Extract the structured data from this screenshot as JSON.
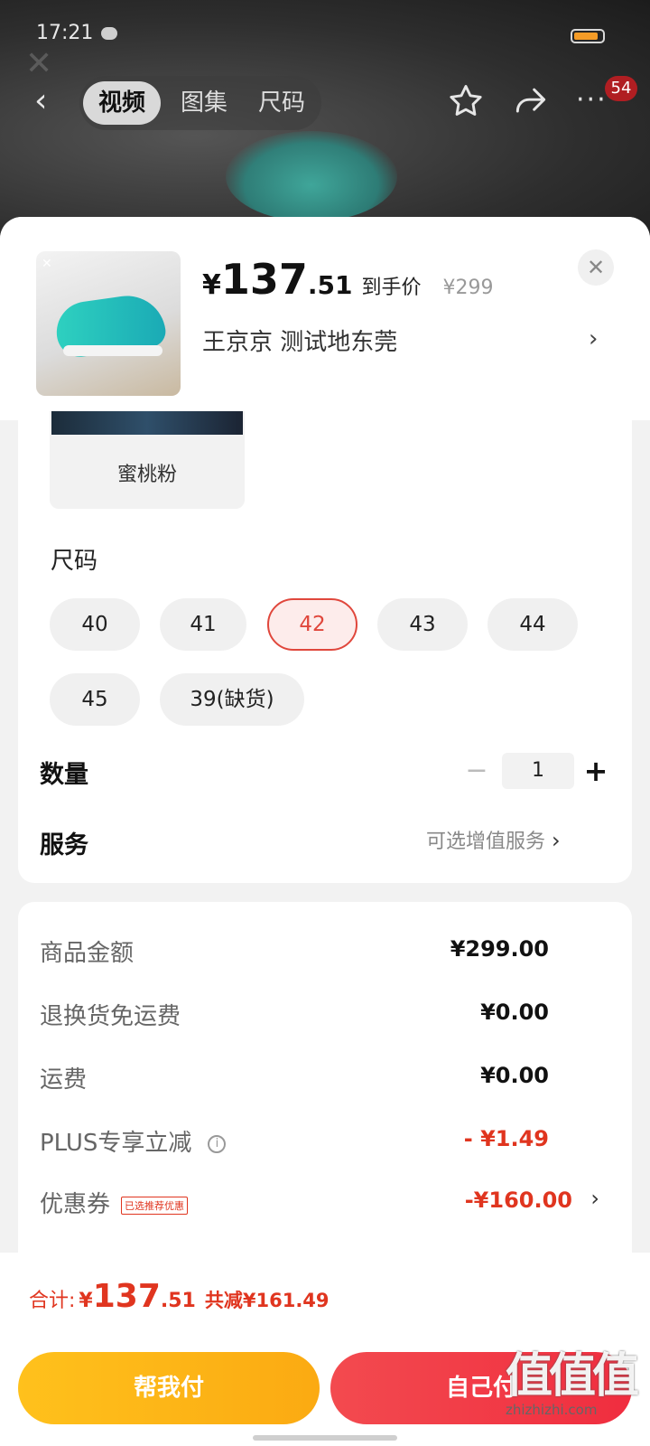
{
  "status_bar": {
    "time": "17:21"
  },
  "header": {
    "tabs": [
      {
        "label": "视频",
        "active": true
      },
      {
        "label": "图集",
        "active": false
      },
      {
        "label": "尺码",
        "active": false
      }
    ],
    "badge_count": "54",
    "icons": [
      "back-icon",
      "star-icon",
      "share-icon",
      "more-icon"
    ]
  },
  "product": {
    "price_symbol": "¥",
    "price_int": "137",
    "price_dec": ".51",
    "price_tag": "到手价",
    "original_price": "¥299",
    "address": "王京京  测试地东莞",
    "address_chevron": "›",
    "close_glyph": "✕"
  },
  "color_option": {
    "label": "蜜桃粉"
  },
  "sizes": {
    "title": "尺码",
    "options": [
      {
        "label": "40",
        "selected": false
      },
      {
        "label": "41",
        "selected": false
      },
      {
        "label": "42",
        "selected": true
      },
      {
        "label": "43",
        "selected": false
      },
      {
        "label": "44",
        "selected": false
      },
      {
        "label": "45",
        "selected": false
      },
      {
        "label": "39(缺货)",
        "selected": false
      }
    ]
  },
  "quantity": {
    "label": "数量",
    "value": "1",
    "minus": "−",
    "plus": "+"
  },
  "service": {
    "label": "服务",
    "hint": "可选增值服务",
    "chevron": "›"
  },
  "price_breakdown": [
    {
      "label": "商品金额",
      "value": "¥299.00",
      "red": false
    },
    {
      "label": "退换货免运费",
      "value": "¥0.00",
      "red": false
    },
    {
      "label": "运费",
      "value": "¥0.00",
      "red": false
    },
    {
      "label": "PLUS专享立减",
      "value": "- ¥1.49",
      "red": true,
      "info": "i"
    },
    {
      "label": "优惠券",
      "value": "-¥160.00",
      "red": true,
      "tag": "已选推荐优惠",
      "chevron": "›"
    }
  ],
  "footer": {
    "total_label": "合计:",
    "total_symbol": "¥",
    "total_int": "137",
    "total_dec": ".51",
    "saved_text": "共减¥161.49",
    "help_pay_label": "帮我付",
    "self_pay_label": "自己付",
    "watermark_big": "值值值",
    "watermark_small": "zhizhizhi.com"
  },
  "colors": {
    "accent_red": "#e0351f",
    "selected_border": "#e0473c",
    "help_button": "#ffc11c",
    "self_button": "#f02d3f",
    "battery": "#f59c27",
    "shoe_teal": "#2fd2c0"
  },
  "battery_level": 0.85
}
